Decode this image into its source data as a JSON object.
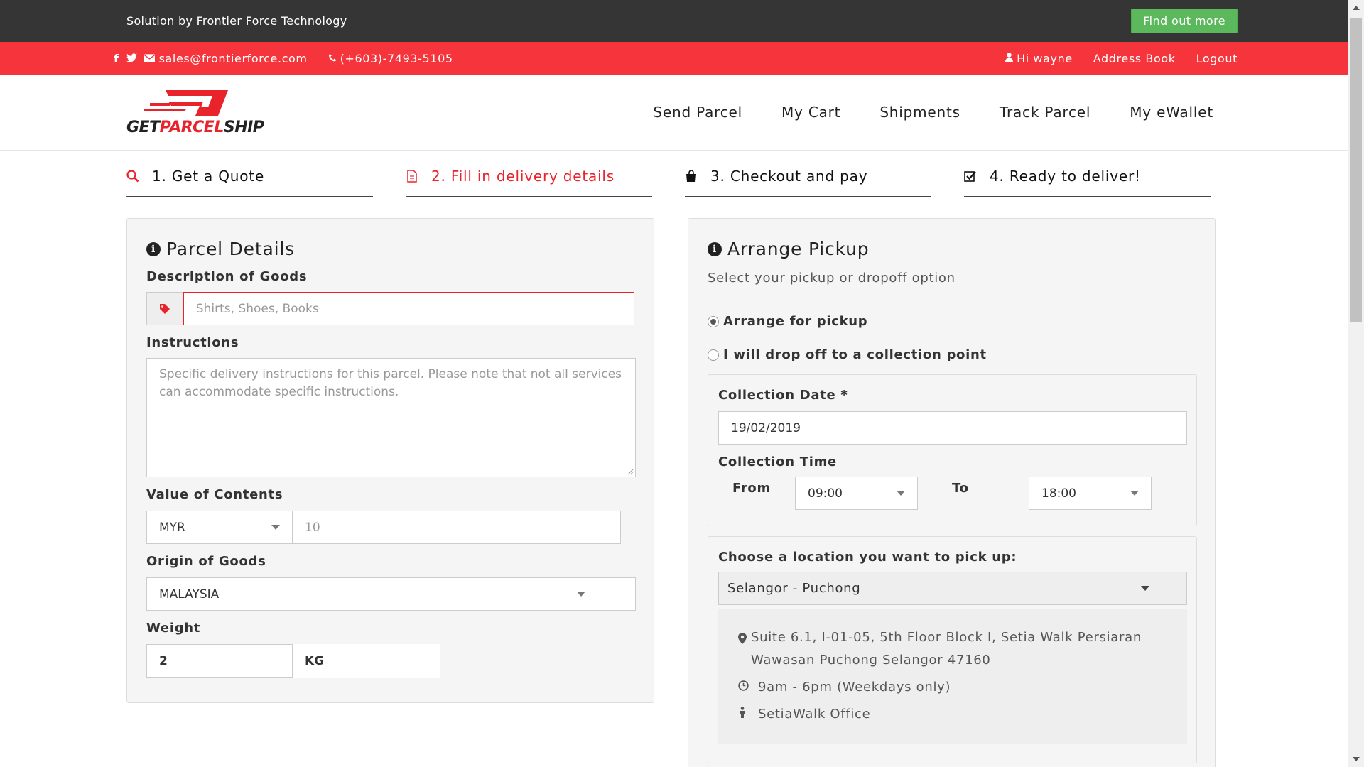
{
  "topbar": {
    "solution": "Solution by Frontier Force Technology",
    "find_out_more": "Find out more"
  },
  "contact": {
    "email": "sales@frontierforce.com",
    "phone": "(+603)-7493-5105",
    "greeting": "Hi wayne",
    "address_book": "Address Book",
    "logout": "Logout"
  },
  "logo": {
    "word_a": "GET",
    "word_b": "PARCEL",
    "word_c": "SHIP"
  },
  "nav": [
    "Send Parcel",
    "My Cart",
    "Shipments",
    "Track Parcel",
    "My eWallet"
  ],
  "steps": [
    "1. Get a Quote",
    "2. Fill in delivery details",
    "3. Checkout and pay",
    "4. Ready to deliver!"
  ],
  "parcel": {
    "title": "Parcel Details",
    "desc_label": "Description of Goods",
    "desc_placeholder": "Shirts, Shoes, Books",
    "instr_label": "Instructions",
    "instr_placeholder": "Specific delivery instructions for this parcel.  Please note that not all services can accommodate specific instructions.",
    "value_label": "Value of Contents",
    "currency": "MYR",
    "value_placeholder": "10",
    "origin_label": "Origin of Goods",
    "origin": "MALAYSIA",
    "weight_label": "Weight",
    "weight": "2",
    "weight_unit": "KG"
  },
  "pickup": {
    "title": "Arrange Pickup",
    "subtitle": "Select your pickup or dropoff option",
    "opt_pickup": "Arrange for pickup",
    "opt_dropoff": "I will drop off to a collection point",
    "date_label": "Collection Date *",
    "date": "19/02/2019",
    "time_label": "Collection Time",
    "from_label": "From",
    "from": "09:00",
    "to_label": "To",
    "to": "18:00",
    "location_label": "Choose a location you want to pick up:",
    "location": "Selangor - Puchong",
    "address": "Suite 6.1, I-01-05, 5th Floor Block I, Setia Walk Persiaran Wawasan Puchong Selangor 47160",
    "hours": "9am - 6pm (Weekdays only)",
    "office": "SetiaWalk Office"
  },
  "colors": {
    "red": "#f6343b",
    "dark": "#353535",
    "green": "#5cb85c"
  }
}
